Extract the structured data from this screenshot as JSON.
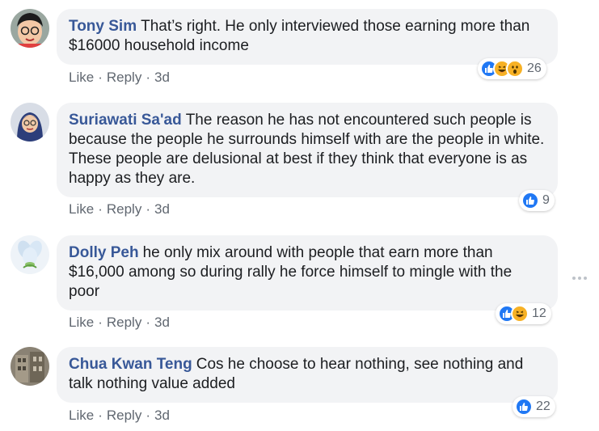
{
  "comments": [
    {
      "author": "Tony Sim",
      "text": "That’s right. He only interviewed those earning more than $16000 household income",
      "actions": {
        "like": "Like",
        "reply": "Reply",
        "time": "3d",
        "sep": "·"
      },
      "reactions": {
        "icons": [
          "like-icon",
          "haha-icon",
          "wow-icon"
        ],
        "count": "26"
      },
      "avatar": "avatar-boy-glasses"
    },
    {
      "author": "Suriawati Sa'ad",
      "text": "The reason he has not encountered such people is because the people he surrounds himself with are the people in white. These people are delusional at best if they think that everyone is as happy as they are.",
      "actions": {
        "like": "Like",
        "reply": "Reply",
        "time": "3d",
        "sep": "·"
      },
      "reactions": {
        "icons": [
          "like-icon"
        ],
        "count": "9"
      },
      "avatar": "avatar-woman-headscarf"
    },
    {
      "author": "Dolly Peh",
      "text": "he only mix around with people that earn more than $16,000 among so during rally he force himself to mingle with the poor",
      "actions": {
        "like": "Like",
        "reply": "Reply",
        "time": "3d",
        "sep": "·"
      },
      "reactions": {
        "icons": [
          "like-icon",
          "haha-icon"
        ],
        "count": "12"
      },
      "avatar": "avatar-flower"
    },
    {
      "author": "Chua Kwan Teng",
      "text": "Cos he choose to hear nothing, see nothing and talk nothing value added",
      "actions": {
        "like": "Like",
        "reply": "Reply",
        "time": "3d",
        "sep": "·"
      },
      "reactions": {
        "icons": [
          "like-icon"
        ],
        "count": "22"
      },
      "avatar": "avatar-building"
    }
  ],
  "more_icon": "more-horizontal-icon",
  "colors": {
    "author": "#385898",
    "bubble": "#f2f3f5",
    "like": "#2078f4",
    "haha": "#f7b125",
    "meta": "#606770"
  }
}
